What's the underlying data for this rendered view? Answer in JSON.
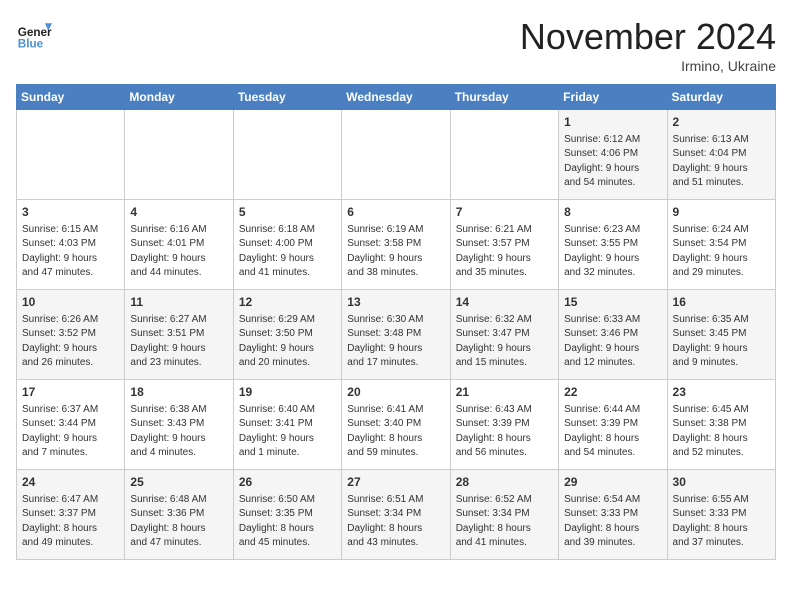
{
  "header": {
    "logo_general": "General",
    "logo_blue": "Blue",
    "month_title": "November 2024",
    "subtitle": "Irmino, Ukraine"
  },
  "days_of_week": [
    "Sunday",
    "Monday",
    "Tuesday",
    "Wednesday",
    "Thursday",
    "Friday",
    "Saturday"
  ],
  "weeks": [
    [
      {
        "day": "",
        "info": ""
      },
      {
        "day": "",
        "info": ""
      },
      {
        "day": "",
        "info": ""
      },
      {
        "day": "",
        "info": ""
      },
      {
        "day": "",
        "info": ""
      },
      {
        "day": "1",
        "info": "Sunrise: 6:12 AM\nSunset: 4:06 PM\nDaylight: 9 hours\nand 54 minutes."
      },
      {
        "day": "2",
        "info": "Sunrise: 6:13 AM\nSunset: 4:04 PM\nDaylight: 9 hours\nand 51 minutes."
      }
    ],
    [
      {
        "day": "3",
        "info": "Sunrise: 6:15 AM\nSunset: 4:03 PM\nDaylight: 9 hours\nand 47 minutes."
      },
      {
        "day": "4",
        "info": "Sunrise: 6:16 AM\nSunset: 4:01 PM\nDaylight: 9 hours\nand 44 minutes."
      },
      {
        "day": "5",
        "info": "Sunrise: 6:18 AM\nSunset: 4:00 PM\nDaylight: 9 hours\nand 41 minutes."
      },
      {
        "day": "6",
        "info": "Sunrise: 6:19 AM\nSunset: 3:58 PM\nDaylight: 9 hours\nand 38 minutes."
      },
      {
        "day": "7",
        "info": "Sunrise: 6:21 AM\nSunset: 3:57 PM\nDaylight: 9 hours\nand 35 minutes."
      },
      {
        "day": "8",
        "info": "Sunrise: 6:23 AM\nSunset: 3:55 PM\nDaylight: 9 hours\nand 32 minutes."
      },
      {
        "day": "9",
        "info": "Sunrise: 6:24 AM\nSunset: 3:54 PM\nDaylight: 9 hours\nand 29 minutes."
      }
    ],
    [
      {
        "day": "10",
        "info": "Sunrise: 6:26 AM\nSunset: 3:52 PM\nDaylight: 9 hours\nand 26 minutes."
      },
      {
        "day": "11",
        "info": "Sunrise: 6:27 AM\nSunset: 3:51 PM\nDaylight: 9 hours\nand 23 minutes."
      },
      {
        "day": "12",
        "info": "Sunrise: 6:29 AM\nSunset: 3:50 PM\nDaylight: 9 hours\nand 20 minutes."
      },
      {
        "day": "13",
        "info": "Sunrise: 6:30 AM\nSunset: 3:48 PM\nDaylight: 9 hours\nand 17 minutes."
      },
      {
        "day": "14",
        "info": "Sunrise: 6:32 AM\nSunset: 3:47 PM\nDaylight: 9 hours\nand 15 minutes."
      },
      {
        "day": "15",
        "info": "Sunrise: 6:33 AM\nSunset: 3:46 PM\nDaylight: 9 hours\nand 12 minutes."
      },
      {
        "day": "16",
        "info": "Sunrise: 6:35 AM\nSunset: 3:45 PM\nDaylight: 9 hours\nand 9 minutes."
      }
    ],
    [
      {
        "day": "17",
        "info": "Sunrise: 6:37 AM\nSunset: 3:44 PM\nDaylight: 9 hours\nand 7 minutes."
      },
      {
        "day": "18",
        "info": "Sunrise: 6:38 AM\nSunset: 3:43 PM\nDaylight: 9 hours\nand 4 minutes."
      },
      {
        "day": "19",
        "info": "Sunrise: 6:40 AM\nSunset: 3:41 PM\nDaylight: 9 hours\nand 1 minute."
      },
      {
        "day": "20",
        "info": "Sunrise: 6:41 AM\nSunset: 3:40 PM\nDaylight: 8 hours\nand 59 minutes."
      },
      {
        "day": "21",
        "info": "Sunrise: 6:43 AM\nSunset: 3:39 PM\nDaylight: 8 hours\nand 56 minutes."
      },
      {
        "day": "22",
        "info": "Sunrise: 6:44 AM\nSunset: 3:39 PM\nDaylight: 8 hours\nand 54 minutes."
      },
      {
        "day": "23",
        "info": "Sunrise: 6:45 AM\nSunset: 3:38 PM\nDaylight: 8 hours\nand 52 minutes."
      }
    ],
    [
      {
        "day": "24",
        "info": "Sunrise: 6:47 AM\nSunset: 3:37 PM\nDaylight: 8 hours\nand 49 minutes."
      },
      {
        "day": "25",
        "info": "Sunrise: 6:48 AM\nSunset: 3:36 PM\nDaylight: 8 hours\nand 47 minutes."
      },
      {
        "day": "26",
        "info": "Sunrise: 6:50 AM\nSunset: 3:35 PM\nDaylight: 8 hours\nand 45 minutes."
      },
      {
        "day": "27",
        "info": "Sunrise: 6:51 AM\nSunset: 3:34 PM\nDaylight: 8 hours\nand 43 minutes."
      },
      {
        "day": "28",
        "info": "Sunrise: 6:52 AM\nSunset: 3:34 PM\nDaylight: 8 hours\nand 41 minutes."
      },
      {
        "day": "29",
        "info": "Sunrise: 6:54 AM\nSunset: 3:33 PM\nDaylight: 8 hours\nand 39 minutes."
      },
      {
        "day": "30",
        "info": "Sunrise: 6:55 AM\nSunset: 3:33 PM\nDaylight: 8 hours\nand 37 minutes."
      }
    ]
  ]
}
